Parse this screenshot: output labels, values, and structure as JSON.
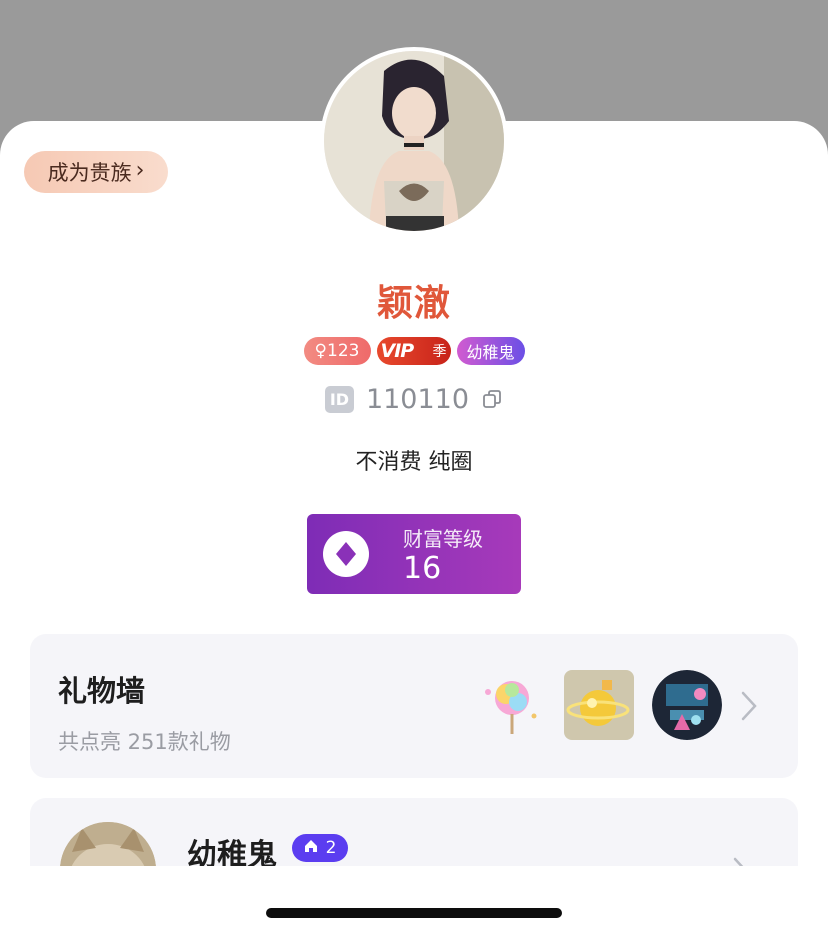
{
  "profile": {
    "noble_button_label": "成为贵族",
    "nickname": "颖澈",
    "gender_badge": "♀123",
    "vip_badge": "VIP",
    "vip_season": "季",
    "title_badge": "幼稚鬼",
    "id_tag": "ID",
    "id_number": "110110",
    "signature": "不消费 纯圈"
  },
  "wealth": {
    "label": "财富等级",
    "level": "16"
  },
  "gift_wall": {
    "title": "礼物墙",
    "subtitle": "共点亮 251款礼物",
    "icons": [
      "cotton-candy-icon",
      "golden-planet-icon",
      "dj-scene-icon"
    ]
  },
  "family": {
    "name": "幼稚鬼",
    "badge_count": "2"
  },
  "colors": {
    "nickname": "#e0573a",
    "wealth_bg": "#8a31b8",
    "family_badge": "#5b3df0"
  }
}
